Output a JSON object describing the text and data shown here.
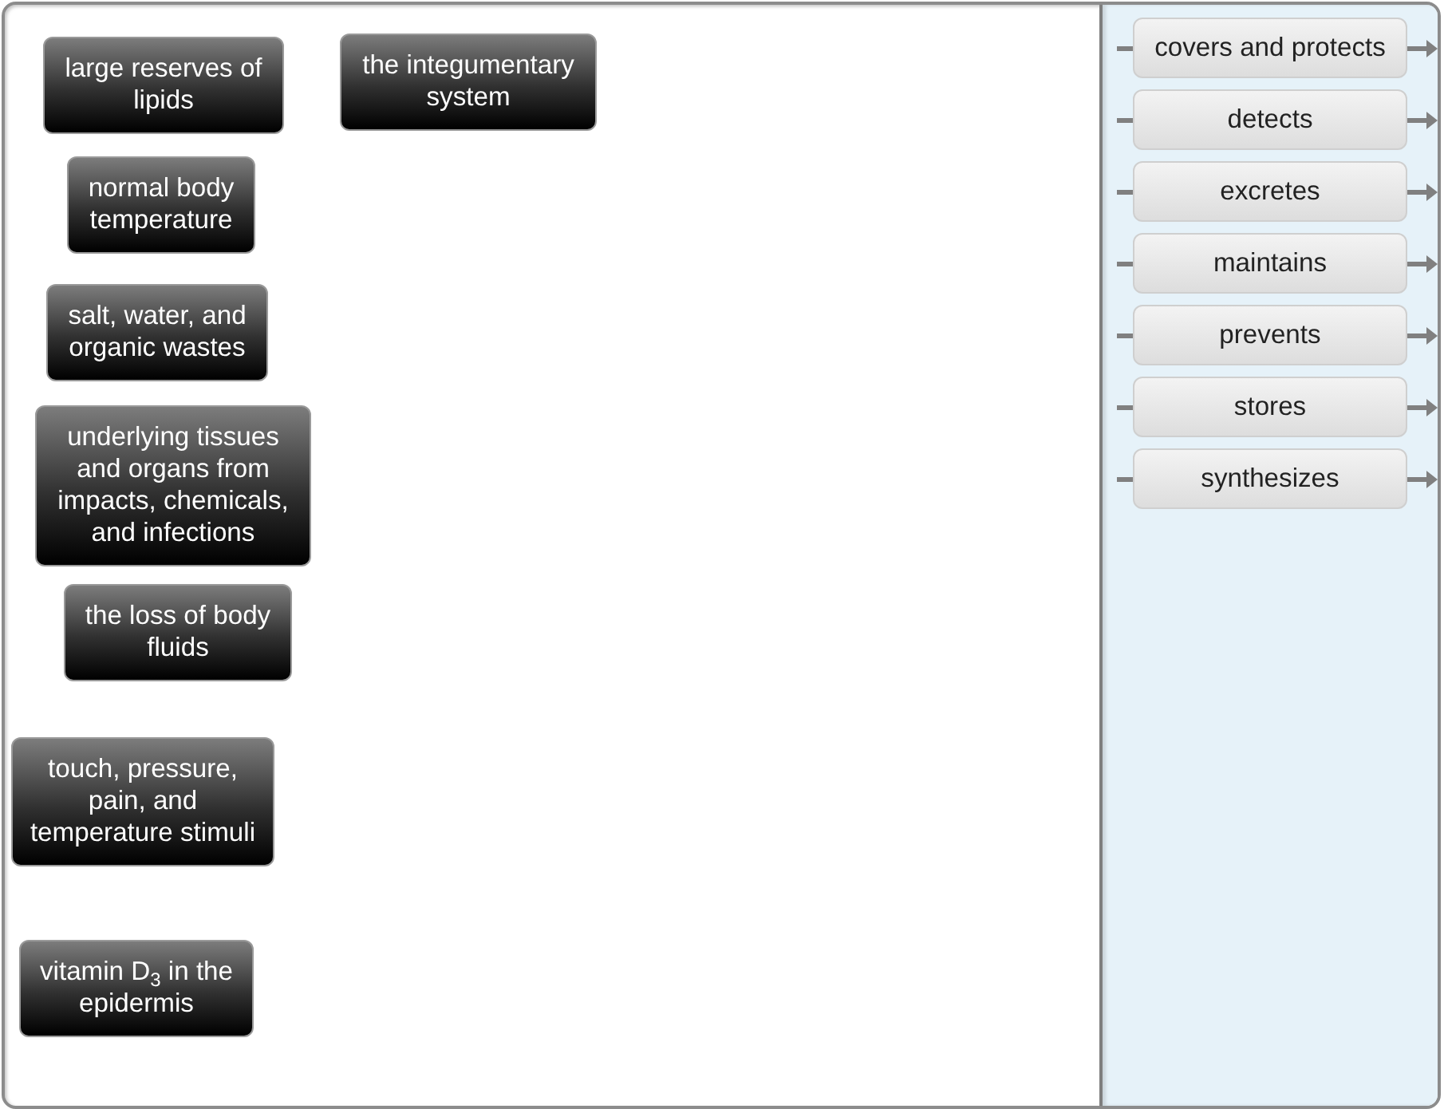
{
  "phrases": [
    {
      "text": "large reserves of lipids"
    },
    {
      "text": "the integumentary system"
    },
    {
      "text": "normal body temperature"
    },
    {
      "text": "salt, water, and organic wastes"
    },
    {
      "text": "underlying tissues and organs from impacts, chemicals, and infections"
    },
    {
      "text": "the loss of body fluids"
    },
    {
      "text": "touch, pressure, pain, and temperature stimuli"
    },
    {
      "text": "vitamin D$_{3}$ in the epidermis"
    }
  ],
  "verbs": [
    {
      "text": "covers and protects"
    },
    {
      "text": "detects"
    },
    {
      "text": "excretes"
    },
    {
      "text": "maintains"
    },
    {
      "text": "prevents"
    },
    {
      "text": "stores"
    },
    {
      "text": "synthesizes"
    }
  ]
}
